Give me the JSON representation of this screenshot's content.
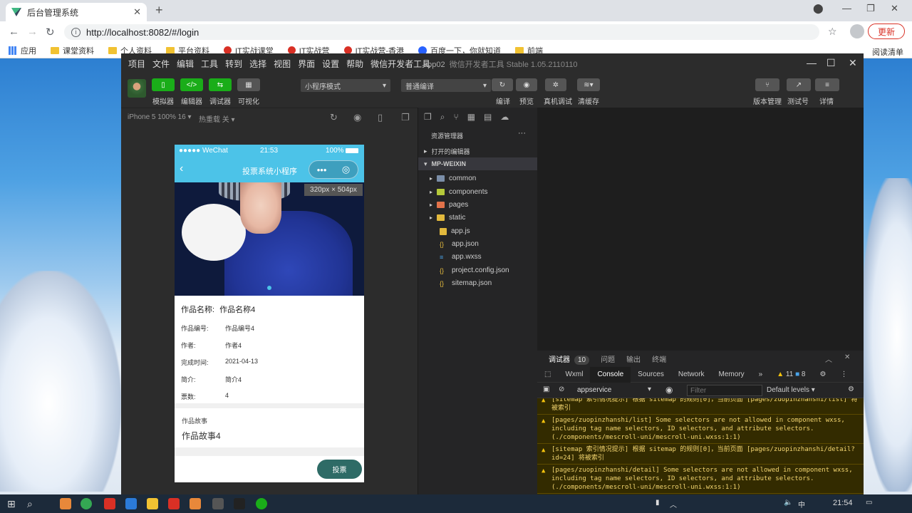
{
  "browser": {
    "tab_title": "后台管理系统",
    "url": "http://localhost:8082/#/login",
    "update_label": "更新",
    "bookmarks": [
      "应用",
      "课堂资料",
      "个人资料",
      "平台资料",
      "IT实战课堂",
      "IT实战营",
      "IT实战营-香港",
      "百度一下，你就知道",
      "前端"
    ],
    "reading_list": "阅读清单"
  },
  "devtools": {
    "menu": [
      "项目",
      "文件",
      "编辑",
      "工具",
      "转到",
      "选择",
      "视图",
      "界面",
      "设置",
      "帮助",
      "微信开发者工具"
    ],
    "title": "app02",
    "subtitle": "微信开发者工具 Stable 1.05.2110110",
    "toolbar": {
      "simulator": "模拟器",
      "editor": "编辑器",
      "debugger": "调试器",
      "visual": "可视化",
      "mode_select": "小程序模式",
      "compile_select": "普通编译",
      "compile": "编译",
      "preview": "预览",
      "real_debug": "真机调试",
      "clear_cache": "清缓存",
      "version": "版本管理",
      "test_id": "测试号",
      "details": "详情"
    },
    "sim_bar": {
      "device": "iPhone 5 100% 16 ▾",
      "hot_reload": "热重载 关 ▾"
    }
  },
  "phone": {
    "carrier": "●●●●● WeChat",
    "time": "21:53",
    "battery": "100%",
    "nav_title": "投票系统小程序",
    "dim_tag": "320px × 504px",
    "work_name_label": "作品名称:",
    "work_name": "作品名称4",
    "fields": [
      {
        "k": "作品编号:",
        "v": "作品编号4"
      },
      {
        "k": "作者:",
        "v": "作者4"
      },
      {
        "k": "完成时间:",
        "v": "2021-04-13"
      },
      {
        "k": "简介:",
        "v": "简介4"
      },
      {
        "k": "票数:",
        "v": "4"
      }
    ],
    "story_label": "作品故事",
    "story": "作品故事4",
    "vote_button": "投票"
  },
  "explorer": {
    "header": "资源管理器",
    "open_editors": "打开的编辑器",
    "root": "MP-WEIXIN",
    "folders": [
      "common",
      "components",
      "pages",
      "static"
    ],
    "files": [
      "app.js",
      "app.json",
      "app.wxss",
      "project.config.json",
      "sitemap.json"
    ],
    "folder_colors": [
      "#7b8ea8",
      "#b5c93a",
      "#e2724a",
      "#e2b93d"
    ]
  },
  "console": {
    "tabs": {
      "debugger": "调试器",
      "count": "10",
      "issues": "问题",
      "output": "输出",
      "terminal": "终端"
    },
    "dev_tabs": [
      "Wxml",
      "Console",
      "Sources",
      "Network",
      "Memory"
    ],
    "warn_count": "11",
    "info_count": "8",
    "context": "appservice",
    "filter_placeholder": "Filter",
    "levels": "Default levels ▾",
    "logs": [
      "[sitemap 索引情况提示] 根据 sitemap 的规则[0]，当前页面 [pages/zuopinzhanshi/list] 将被索引",
      "[pages/zuopinzhanshi/list] Some selectors are not allowed in component wxss, including tag name selectors, ID selectors, and attribute selectors.(./components/mescroll-uni/mescroll-uni.wxss:1:1)",
      "[sitemap 索引情况提示] 根据 sitemap 的规则[0]，当前页面 [pages/zuopinzhanshi/detail?id=24] 将被索引",
      "[pages/zuopinzhanshi/detail] Some selectors are not allowed in component wxss, including tag name selectors, ID selectors, and attribute selectors.(./components/mescroll-uni/mescroll-uni.wxss:1:1)"
    ]
  },
  "taskbar": {
    "ime": "中",
    "time": "21:54"
  }
}
